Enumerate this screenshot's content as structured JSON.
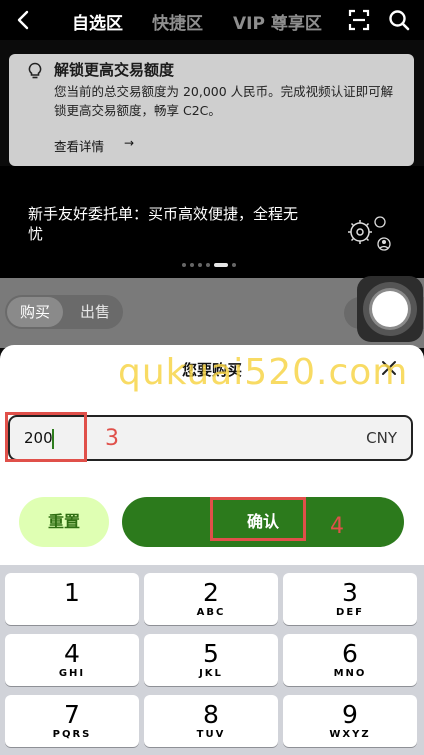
{
  "nav": {
    "tabs": [
      {
        "label": "自选区",
        "active": true
      },
      {
        "label": "快捷区",
        "active": false
      },
      {
        "label": "VIP 尊享区",
        "active": false
      }
    ]
  },
  "notice": {
    "title": "解锁更高交易额度",
    "description": "您当前的总交易额度为 20,000 人民币。完成视频认证即可解锁更高交易额度，畅享 C2C。",
    "link": "查看详情"
  },
  "banner": {
    "slogan": "新手友好委托单：买币高效便捷，全程无忧"
  },
  "trade_tabs": {
    "buy": "购买",
    "sell": "出售"
  },
  "sheet": {
    "title": "您要购买",
    "amount_value": "200",
    "currency": "CNY",
    "reset_label": "重置",
    "confirm_label": "确认"
  },
  "annotations": [
    "3",
    "4"
  ],
  "watermark": "qukuai520.com",
  "keypad": {
    "keys": [
      {
        "digit": "1",
        "letters": ""
      },
      {
        "digit": "2",
        "letters": "ABC"
      },
      {
        "digit": "3",
        "letters": "DEF"
      },
      {
        "digit": "4",
        "letters": "GHI"
      },
      {
        "digit": "5",
        "letters": "JKL"
      },
      {
        "digit": "6",
        "letters": "MNO"
      },
      {
        "digit": "7",
        "letters": "PQRS"
      },
      {
        "digit": "8",
        "letters": "TUV"
      },
      {
        "digit": "9",
        "letters": "WXYZ"
      }
    ]
  },
  "colors": {
    "confirm": "#2c7a1c",
    "reset_bg": "#dfffb3",
    "annotation": "#e0504a"
  }
}
